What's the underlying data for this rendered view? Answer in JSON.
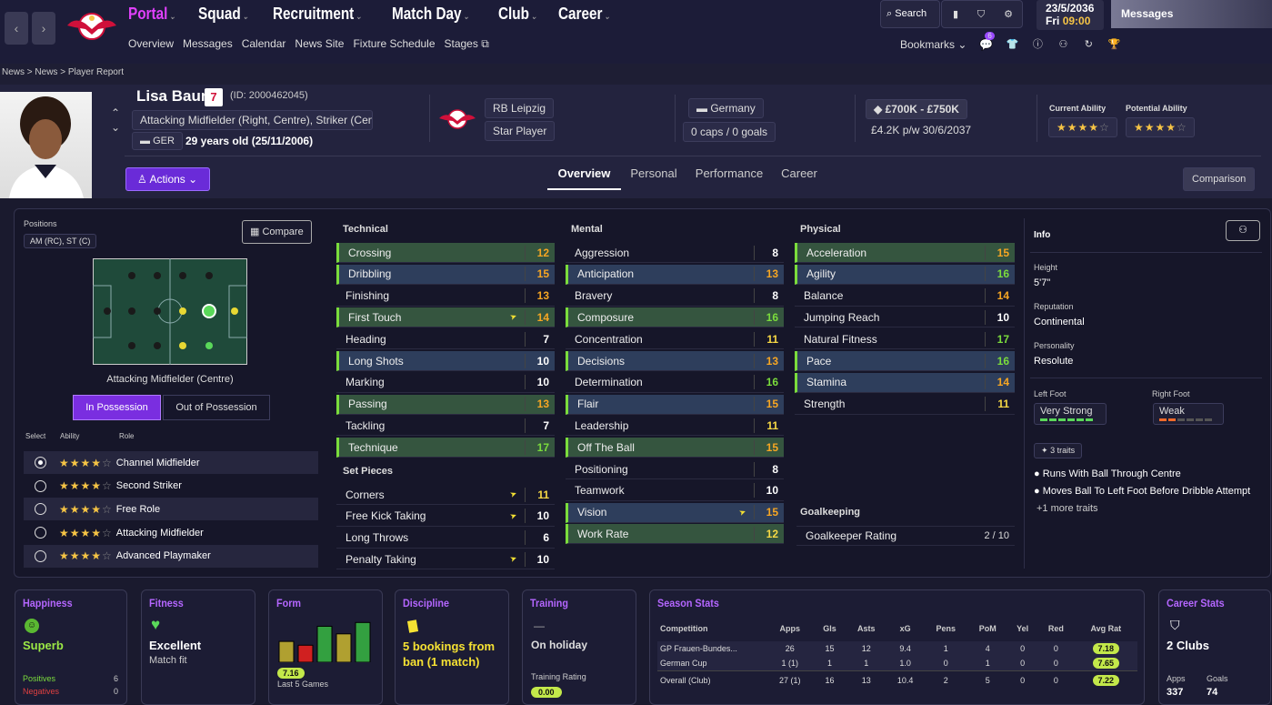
{
  "nav": {
    "items": [
      {
        "label": "Portal"
      },
      {
        "label": "Squad"
      },
      {
        "label": "Recruitment"
      },
      {
        "label": "Match Day"
      },
      {
        "label": "Club"
      },
      {
        "label": "Career"
      }
    ],
    "sub_items": [
      "Overview",
      "Messages",
      "Calendar",
      "News Site",
      "Fixture Schedule",
      "Stages"
    ],
    "search_label": "Search",
    "date": "23/5/2036",
    "day": "Fri",
    "time": "09:00",
    "messages_label": "Messages",
    "bookmarks_label": "Bookmarks",
    "notification_count": "6"
  },
  "breadcrumb": [
    "News",
    "News",
    "Player Report"
  ],
  "player": {
    "name": "Lisa Baum",
    "number": "7",
    "id": "(ID: 2000462045)",
    "position": "Attacking Midfielder (Right, Centre), Striker (Cent...",
    "nationality_code": "GER",
    "age": "29 years old (25/11/2006)",
    "club": "RB Leipzig",
    "status": "Star Player",
    "nation": "Germany",
    "caps": "0 caps / 0 goals",
    "value": "£700K - £750K",
    "wage": "£4.2K p/w 30/6/2037",
    "current_ability_label": "Current Ability",
    "potential_ability_label": "Potential Ability",
    "current_ability_stars": 4.5,
    "potential_ability_stars": 4.5,
    "actions_label": "Actions",
    "comparison_label": "Comparison"
  },
  "tabs": [
    "Overview",
    "Personal",
    "Performance",
    "Career"
  ],
  "positions": {
    "label": "Positions",
    "value": "AM (RC), ST (C)",
    "compare_label": "Compare",
    "caption": "Attacking Midfielder (Centre)",
    "in_possession": "In Possession",
    "out_possession": "Out of Possession",
    "headers": [
      "Select",
      "Ability",
      "Role"
    ],
    "roles": [
      {
        "name": "Channel Midfielder",
        "selected": true
      },
      {
        "name": "Second Striker",
        "selected": false
      },
      {
        "name": "Free Role",
        "selected": false
      },
      {
        "name": "Attacking Midfielder",
        "selected": false
      },
      {
        "name": "Advanced Playmaker",
        "selected": false
      }
    ]
  },
  "technical": {
    "title": "Technical",
    "rows": [
      {
        "name": "Crossing",
        "value": "12",
        "c": "o",
        "bg": "hi",
        "arrow": false
      },
      {
        "name": "Dribbling",
        "value": "15",
        "c": "o",
        "bg": "hb",
        "arrow": false
      },
      {
        "name": "Finishing",
        "value": "13",
        "c": "o",
        "bg": "",
        "arrow": false
      },
      {
        "name": "First Touch",
        "value": "14",
        "c": "o",
        "bg": "hi",
        "arrow": true
      },
      {
        "name": "Heading",
        "value": "7",
        "c": "w",
        "bg": "",
        "arrow": false
      },
      {
        "name": "Long Shots",
        "value": "10",
        "c": "w",
        "bg": "hb",
        "arrow": false
      },
      {
        "name": "Marking",
        "value": "10",
        "c": "w",
        "bg": "",
        "arrow": false
      },
      {
        "name": "Passing",
        "value": "13",
        "c": "o",
        "bg": "hi",
        "arrow": false
      },
      {
        "name": "Tackling",
        "value": "7",
        "c": "w",
        "bg": "",
        "arrow": false
      },
      {
        "name": "Technique",
        "value": "17",
        "c": "g",
        "bg": "hi",
        "arrow": false
      }
    ]
  },
  "set_pieces": {
    "title": "Set Pieces",
    "rows": [
      {
        "name": "Corners",
        "value": "11",
        "c": "y",
        "bg": "",
        "arrow": true
      },
      {
        "name": "Free Kick Taking",
        "value": "10",
        "c": "w",
        "bg": "",
        "arrow": true
      },
      {
        "name": "Long Throws",
        "value": "6",
        "c": "w",
        "bg": "",
        "arrow": false
      },
      {
        "name": "Penalty Taking",
        "value": "10",
        "c": "w",
        "bg": "",
        "arrow": true
      }
    ]
  },
  "mental": {
    "title": "Mental",
    "rows": [
      {
        "name": "Aggression",
        "value": "8",
        "c": "w",
        "bg": "",
        "arrow": false
      },
      {
        "name": "Anticipation",
        "value": "13",
        "c": "o",
        "bg": "hb",
        "arrow": false
      },
      {
        "name": "Bravery",
        "value": "8",
        "c": "w",
        "bg": "",
        "arrow": false
      },
      {
        "name": "Composure",
        "value": "16",
        "c": "g",
        "bg": "hi",
        "arrow": false
      },
      {
        "name": "Concentration",
        "value": "11",
        "c": "y",
        "bg": "",
        "arrow": false
      },
      {
        "name": "Decisions",
        "value": "13",
        "c": "o",
        "bg": "hb",
        "arrow": false
      },
      {
        "name": "Determination",
        "value": "16",
        "c": "g",
        "bg": "",
        "arrow": false
      },
      {
        "name": "Flair",
        "value": "15",
        "c": "o",
        "bg": "hb",
        "arrow": false
      },
      {
        "name": "Leadership",
        "value": "11",
        "c": "y",
        "bg": "",
        "arrow": false
      },
      {
        "name": "Off The Ball",
        "value": "15",
        "c": "o",
        "bg": "hi",
        "arrow": false
      },
      {
        "name": "Positioning",
        "value": "8",
        "c": "w",
        "bg": "",
        "arrow": false
      },
      {
        "name": "Teamwork",
        "value": "10",
        "c": "w",
        "bg": "",
        "arrow": false
      },
      {
        "name": "Vision",
        "value": "15",
        "c": "o",
        "bg": "hb",
        "arrow": true
      },
      {
        "name": "Work Rate",
        "value": "12",
        "c": "y",
        "bg": "hi",
        "arrow": false
      }
    ]
  },
  "physical": {
    "title": "Physical",
    "rows": [
      {
        "name": "Acceleration",
        "value": "15",
        "c": "o",
        "bg": "hi",
        "arrow": false
      },
      {
        "name": "Agility",
        "value": "16",
        "c": "g",
        "bg": "hb",
        "arrow": false
      },
      {
        "name": "Balance",
        "value": "14",
        "c": "o",
        "bg": "",
        "arrow": false
      },
      {
        "name": "Jumping Reach",
        "value": "10",
        "c": "w",
        "bg": "",
        "arrow": false
      },
      {
        "name": "Natural Fitness",
        "value": "17",
        "c": "g",
        "bg": "",
        "arrow": false
      },
      {
        "name": "Pace",
        "value": "16",
        "c": "g",
        "bg": "hb",
        "arrow": false
      },
      {
        "name": "Stamina",
        "value": "14",
        "c": "o",
        "bg": "hb",
        "arrow": false
      },
      {
        "name": "Strength",
        "value": "11",
        "c": "y",
        "bg": "",
        "arrow": false
      }
    ]
  },
  "goalkeeping": {
    "title": "Goalkeeping",
    "label": "Goalkeeper Rating",
    "value": "2 / 10"
  },
  "info": {
    "title": "Info",
    "height_label": "Height",
    "height": "5'7\"",
    "reputation_label": "Reputation",
    "reputation": "Continental",
    "personality_label": "Personality",
    "personality": "Resolute",
    "left_foot_label": "Left Foot",
    "left_foot": "Very Strong",
    "right_foot_label": "Right Foot",
    "right_foot": "Weak",
    "traits_label": "3 traits",
    "traits": [
      "Runs With Ball Through Centre",
      "Moves Ball To Left Foot Before Dribble Attempt"
    ],
    "more_traits": "+1 more traits"
  },
  "happiness": {
    "title": "Happiness",
    "value": "Superb",
    "positives_label": "Positives",
    "positives": "6",
    "negatives_label": "Negatives",
    "negatives": "0"
  },
  "fitness": {
    "title": "Fitness",
    "value": "Excellent",
    "sub": "Match fit"
  },
  "form": {
    "title": "Form",
    "rating": "7.16",
    "label": "Last 5 Games",
    "bars": [
      6.6,
      6.4,
      7.4,
      7.0,
      7.6
    ],
    "colors": [
      "#b0a030",
      "#d02020",
      "#33a040",
      "#b0a030",
      "#33a040"
    ]
  },
  "discipline": {
    "title": "Discipline",
    "value": "5 bookings from ban (1 match)"
  },
  "training": {
    "title": "Training",
    "dash": "—",
    "value": "On holiday",
    "rating_label": "Training Rating",
    "rating": "0.00"
  },
  "season_stats": {
    "title": "Season Stats",
    "headers": [
      "Competition",
      "Apps",
      "Gls",
      "Asts",
      "xG",
      "Pens",
      "PoM",
      "Yel",
      "Red",
      "Avg Rat"
    ],
    "rows": [
      [
        "GP Frauen-Bundes...",
        "26",
        "15",
        "12",
        "9.4",
        "1",
        "4",
        "0",
        "0",
        "7.18"
      ],
      [
        "German Cup",
        "1 (1)",
        "1",
        "1",
        "1.0",
        "0",
        "1",
        "0",
        "0",
        "7.65"
      ],
      [
        "Overall (Club)",
        "27 (1)",
        "16",
        "13",
        "10.4",
        "2",
        "5",
        "0",
        "0",
        "7.22"
      ]
    ]
  },
  "career_stats": {
    "title": "Career Stats",
    "clubs": "2 Clubs",
    "apps_label": "Apps",
    "apps": "337",
    "goals_label": "Goals",
    "goals": "74"
  },
  "colors": {
    "accent": "#b466ff",
    "positive": "#7bdc3c"
  }
}
